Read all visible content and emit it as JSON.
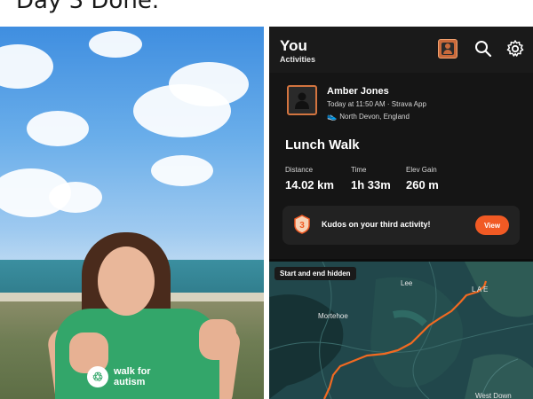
{
  "caption": "Day 3 Done.",
  "photo": {
    "logo_text": "walk for\nautism"
  },
  "app": {
    "title": "You",
    "subtitle": "Activities",
    "icons": {
      "avatar": "avatar-icon",
      "search": "search-icon",
      "settings": "gear-icon"
    },
    "activity": {
      "athlete": "Amber Jones",
      "meta": "Today at 11:50 AM · Strava App",
      "location": "North Devon, England",
      "name": "Lunch Walk",
      "stats": [
        {
          "label": "Distance",
          "value": "14.02 km"
        },
        {
          "label": "Time",
          "value": "1h 33m"
        },
        {
          "label": "Elev Gain",
          "value": "260 m"
        }
      ],
      "kudos_text": "Kudos on your third activity!",
      "kudos_badge": "3",
      "view_label": "View"
    },
    "map": {
      "tag": "Start and end hidden",
      "places": {
        "lee": "Lee",
        "mortehoe": "Mortehoe",
        "west_down": "West Down",
        "corner": "L A E"
      }
    },
    "colors": {
      "accent": "#f15a24",
      "background": "#0d0d0d",
      "route": "#f26a21"
    }
  }
}
